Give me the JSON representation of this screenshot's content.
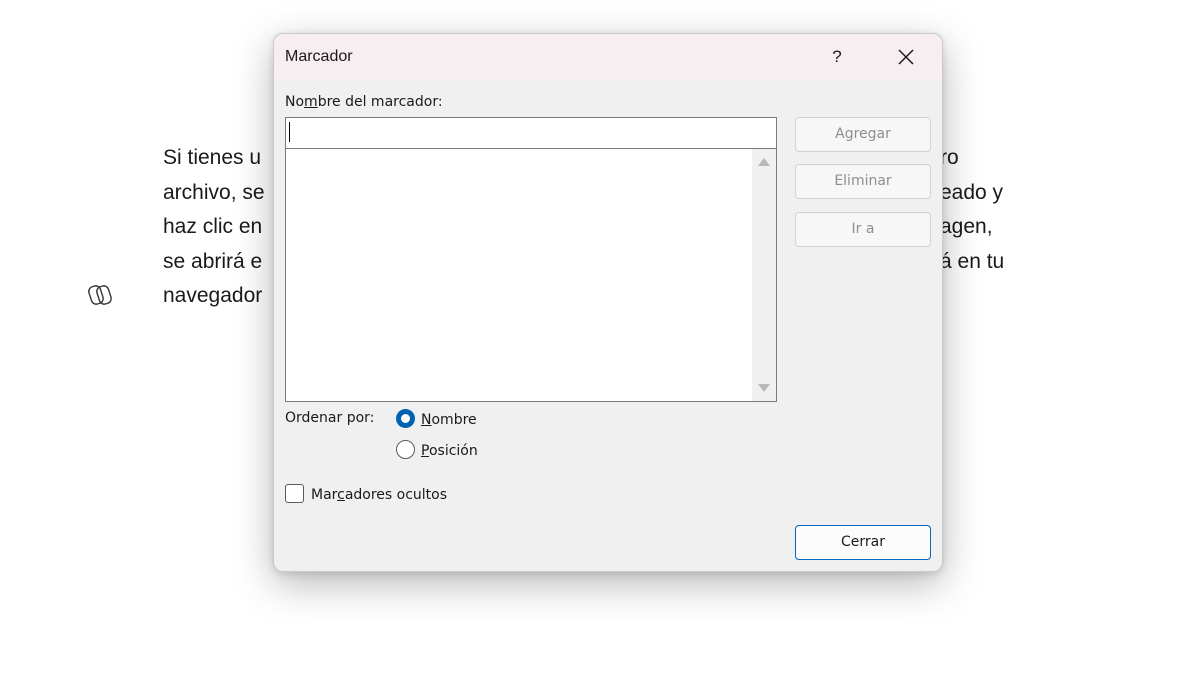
{
  "document": {
    "lines": [
      {
        "left": "Si tienes u",
        "right": "ro"
      },
      {
        "left": "archivo, se",
        "right": "eado y"
      },
      {
        "left": "haz clic en",
        "right": "agen,"
      },
      {
        "left": "se abrirá e",
        "right": "á en tu"
      },
      {
        "left": "navegador",
        "right": ""
      }
    ]
  },
  "dialog": {
    "title": "Marcador",
    "help_label": "?",
    "name_label_pre": "No",
    "name_label_u": "m",
    "name_label_post": "bre del marcador:",
    "name_value": "",
    "buttons": {
      "add": "Agregar",
      "delete": "Eliminar",
      "goto": "Ir a",
      "close": "Cerrar"
    },
    "sort_label": "Ordenar por:",
    "sort_options": [
      {
        "pre": "",
        "u": "N",
        "post": "ombre",
        "checked": true
      },
      {
        "pre": "",
        "u": "P",
        "post": "osición",
        "checked": false
      }
    ],
    "hidden_pre": "Mar",
    "hidden_u": "c",
    "hidden_post": "adores ocultos",
    "hidden_checked": false
  },
  "colors": {
    "accent": "#0063b1",
    "titlebar": "#f6eef0",
    "dialog_bg": "#f0f0f0"
  }
}
